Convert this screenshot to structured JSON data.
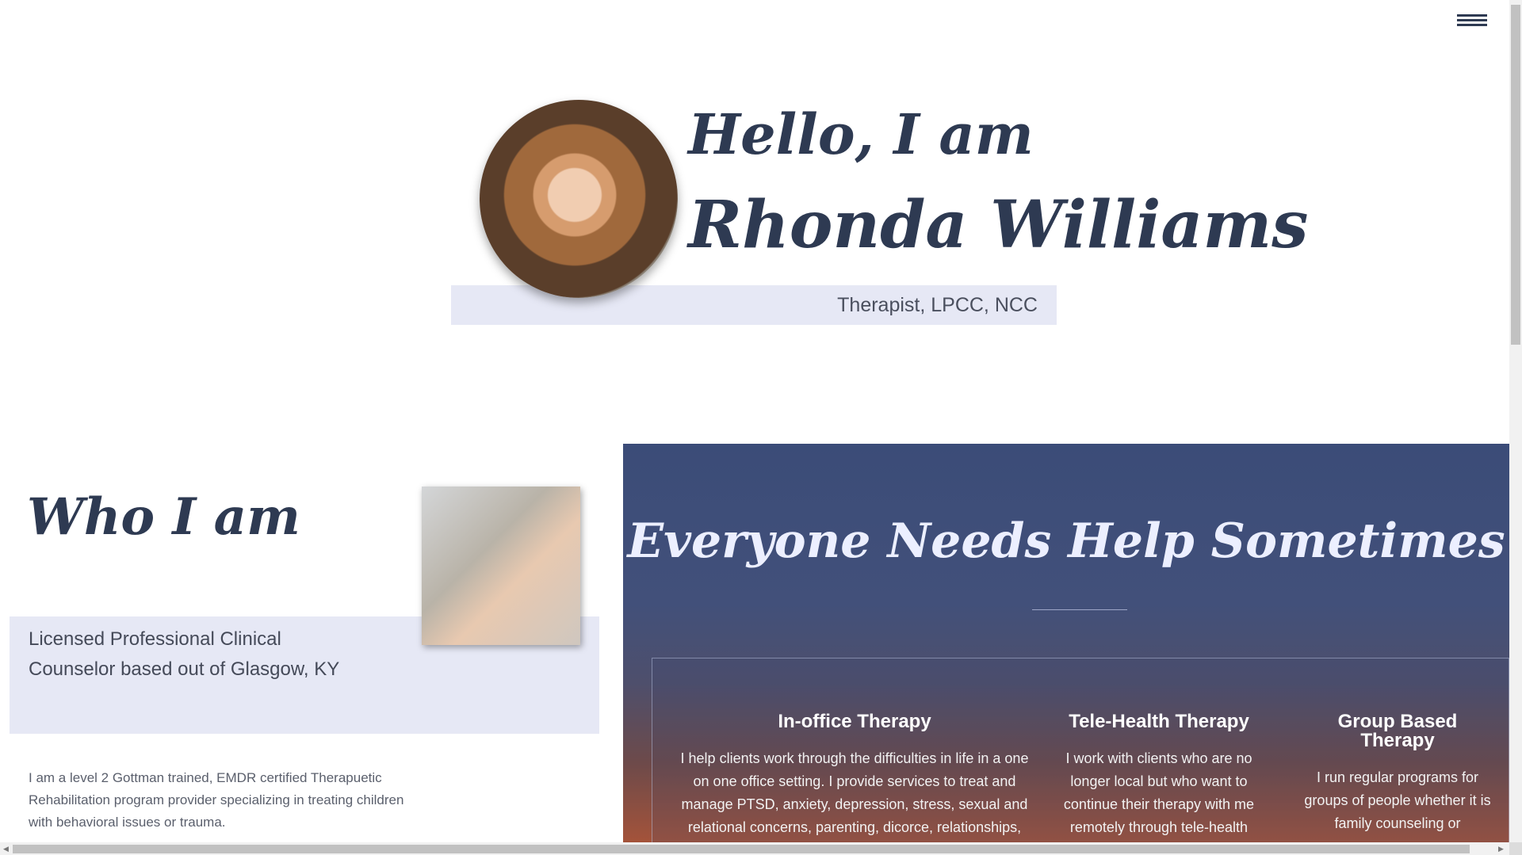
{
  "hero": {
    "greeting": "Hello, I am",
    "name": "Rhonda Williams",
    "credentials": "Therapist, LPCC, NCC"
  },
  "about": {
    "heading": "Who I am",
    "summary_line1": "Licensed Professional Clinical",
    "summary_line2": "Counselor based out of Glasgow, KY",
    "bio": "I am a level 2 Gottman trained, EMDR certified Therapuetic Rehabilitation program provider specializing in treating children with behavioral issues or trauma."
  },
  "help": {
    "heading": "Everyone Needs Help Sometimes",
    "services": [
      {
        "title": "In-office Therapy",
        "text": "I help clients work through the difficulties in life in a one on one office setting. I provide services to treat and manage PTSD, anxiety, depression, stress, sexual and relational concerns, parenting, dicorce, relationships, OCD,"
      },
      {
        "title": "Tele-Health Therapy",
        "text": "I work with clients who are no longer local but who want to continue their therapy with me remotely through tele-health"
      },
      {
        "title": "Group Based Therapy",
        "text": "I run regular programs for groups of people whether it is family counseling or"
      }
    ]
  },
  "icons": {
    "menu": "hamburger-menu-icon"
  },
  "colors": {
    "heading": "#2e3a52",
    "band": "#e6e8f5",
    "panel": "#3b4c78"
  }
}
